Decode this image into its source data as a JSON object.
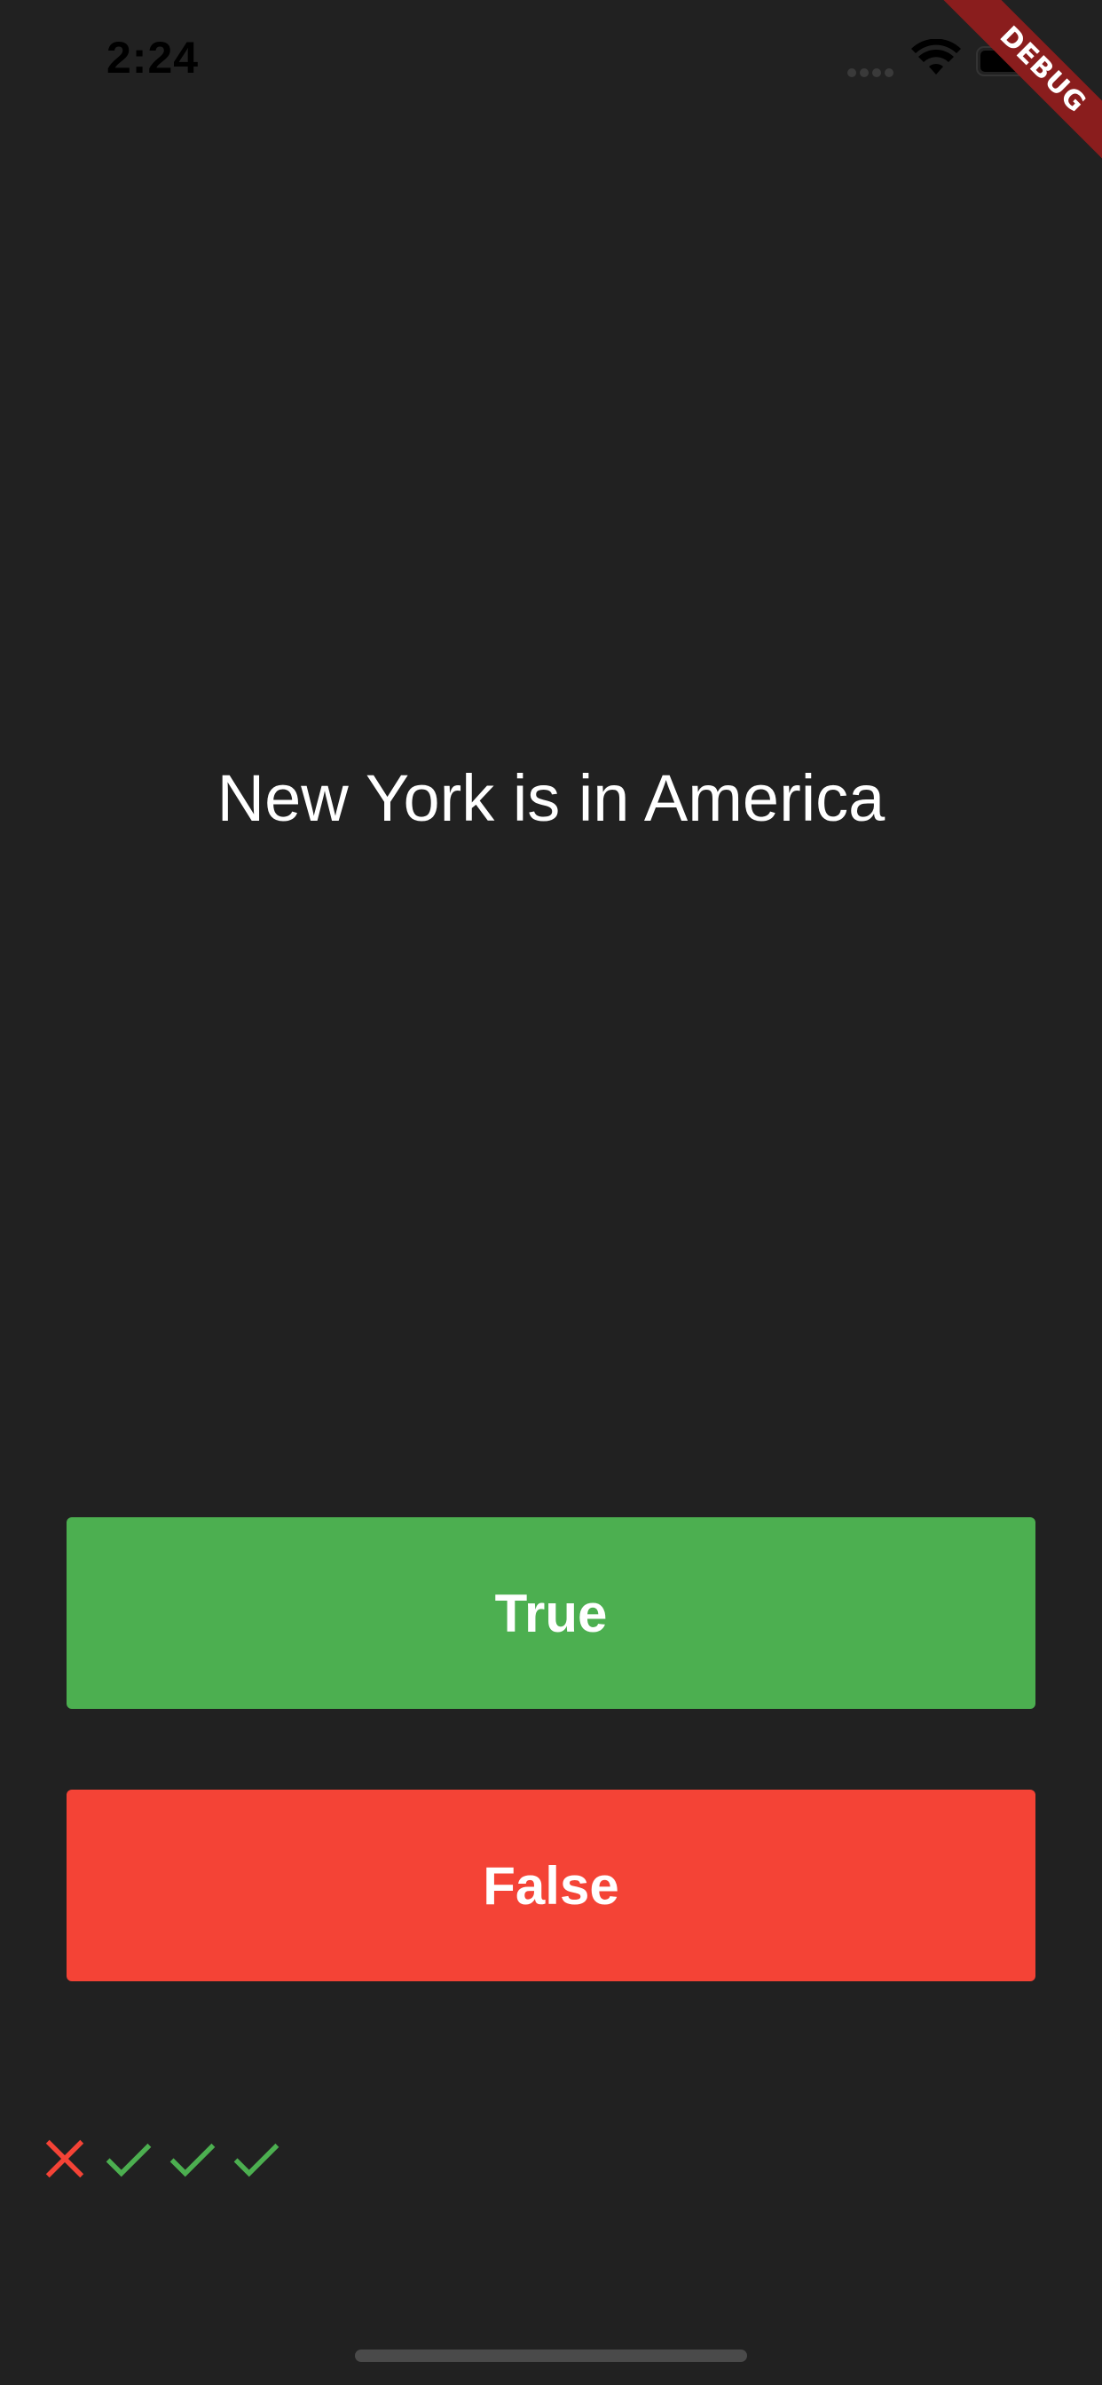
{
  "status_bar": {
    "time": "2:24",
    "wifi_icon": "wifi-icon",
    "battery_icon": "battery-icon"
  },
  "debug_banner": {
    "label": "DEBUG",
    "color": "#8a1d1d"
  },
  "quiz": {
    "question": "New York is in America",
    "true_label": "True",
    "false_label": "False",
    "true_color": "#4caf50",
    "false_color": "#f44336"
  },
  "score_keeper": [
    {
      "result": "wrong",
      "icon": "close-icon",
      "color": "#f44336"
    },
    {
      "result": "correct",
      "icon": "check-icon",
      "color": "#4caf50"
    },
    {
      "result": "correct",
      "icon": "check-icon",
      "color": "#4caf50"
    },
    {
      "result": "correct",
      "icon": "check-icon",
      "color": "#4caf50"
    }
  ],
  "colors": {
    "background": "#212121"
  }
}
